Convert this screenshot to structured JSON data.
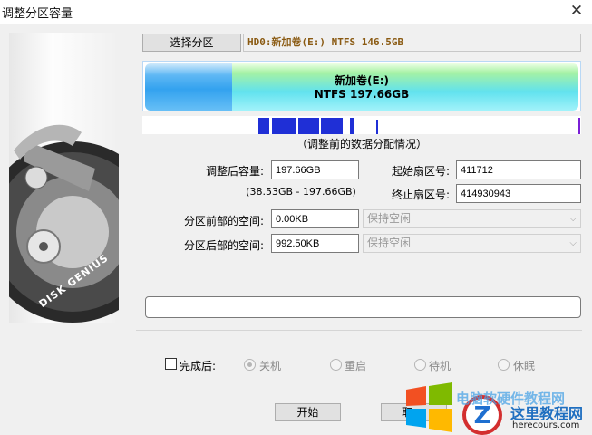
{
  "window": {
    "title": "调整分区容量",
    "close_glyph": "✕"
  },
  "select_partition_label": "选择分区",
  "partition_info": "HD0:新加卷(E:) NTFS 146.5GB",
  "bar": {
    "name": "新加卷(E:)",
    "fs_size": "NTFS 197.66GB"
  },
  "caption": "（调整前的数据分配情况）",
  "form": {
    "size_label": "调整后容量:",
    "size_value": "197.66GB",
    "range_text": "(38.53GB - 197.66GB)",
    "start_sector_label": "起始扇区号:",
    "start_sector_value": "411712",
    "end_sector_label": "终止扇区号:",
    "end_sector_value": "414930943",
    "space_before_label": "分区前部的空间:",
    "space_before_value": "0.00KB",
    "space_before_option": "保持空闲",
    "space_after_label": "分区后部的空间:",
    "space_after_value": "992.50KB",
    "space_after_option": "保持空闲"
  },
  "after_done": {
    "label": "完成后:",
    "options": [
      "关机",
      "重启",
      "待机",
      "休眠"
    ],
    "selected": "关机"
  },
  "buttons": {
    "start": "开始",
    "cancel": "取"
  },
  "side_brand": "DISK GENIUS",
  "watermark": {
    "name": "这里教程网",
    "url": "herecours.com",
    "text": "电脑软硬件教程网"
  },
  "colors": {
    "accent_blue": "#33a2ef",
    "free_cyan": "#61e2ee",
    "info_brown": "#8a5a12"
  }
}
